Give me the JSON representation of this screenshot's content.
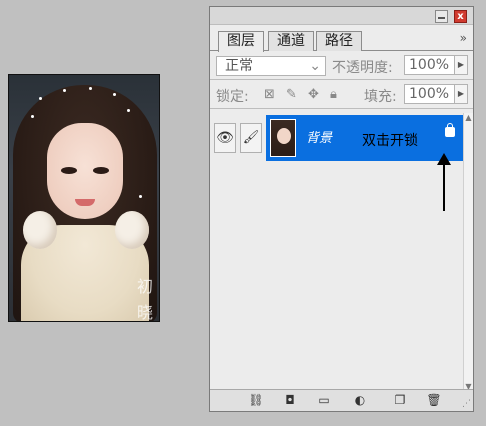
{
  "photo": {
    "watermark_chars": [
      "初",
      "晓"
    ]
  },
  "panel": {
    "tabs": [
      {
        "label": "图层",
        "active": true
      },
      {
        "label": "通道",
        "active": false
      },
      {
        "label": "路径",
        "active": false
      }
    ],
    "more_label": "»",
    "close_label": "x",
    "blend_mode": "正常",
    "opacity_label": "不透明度:",
    "opacity_value": "100%",
    "lock_label": "锁定:",
    "fill_label": "填充:",
    "fill_value": "100%",
    "layers": [
      {
        "name": "背景",
        "selected": true
      }
    ],
    "hint_text": "双击开锁"
  },
  "colors": {
    "selection": "#0a6fe0",
    "panel_bg": "#ececec",
    "close_btn": "#d03a2f"
  },
  "icons": {
    "visibility": "eye-icon",
    "brush": "brush-icon",
    "lock": "lock-icon",
    "bottom": [
      "link-layers-icon",
      "add-mask-icon",
      "new-group-icon",
      "adjustment-layer-icon",
      "new-layer-icon",
      "delete-layer-icon"
    ]
  }
}
